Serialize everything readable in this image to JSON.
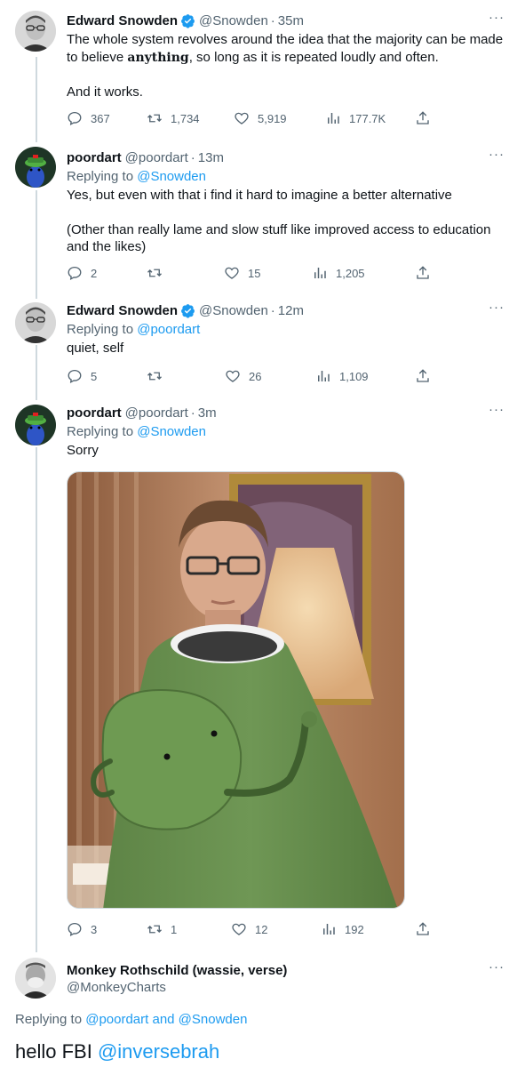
{
  "tweets": [
    {
      "name": "Edward Snowden",
      "handle": "@Snowden",
      "time": "35m",
      "verified": true,
      "text_1": "The whole system revolves around the idea that the majority can be made to believe ",
      "text_bold": "anything",
      "text_2": ", so long as it is repeated loudly and often.",
      "text_3": "And it works.",
      "replies": "367",
      "retweets": "1,734",
      "likes": "5,919",
      "views": "177.7K"
    },
    {
      "name": "poordart",
      "handle": "@poordart",
      "time": "13m",
      "replying_prefix": "Replying to ",
      "replying_to": "@Snowden",
      "text_1": "Yes, but even with that i find it hard to imagine a better alternative",
      "text_2": "(Other than really lame and slow stuff like improved access to education and the likes)",
      "replies": "2",
      "retweets": "",
      "likes": "15",
      "views": "1,205"
    },
    {
      "name": "Edward Snowden",
      "handle": "@Snowden",
      "time": "12m",
      "verified": true,
      "replying_prefix": "Replying to ",
      "replying_to": "@poordart",
      "text_1": "quiet, self",
      "replies": "5",
      "retweets": "",
      "likes": "26",
      "views": "1,109"
    },
    {
      "name": "poordart",
      "handle": "@poordart",
      "time": "3m",
      "replying_prefix": "Replying to ",
      "replying_to": "@Snowden",
      "text_1": "Sorry",
      "replies": "3",
      "retweets": "1",
      "likes": "12",
      "views": "192"
    },
    {
      "name": "Monkey Rothschild (wassie, verse)",
      "handle": "@MonkeyCharts",
      "replying_prefix": "Replying to ",
      "replying_to": "@poordart and @Snowden",
      "text_1": "hello FBI ",
      "mention": "@inversebrah"
    }
  ],
  "more_label": "···",
  "dot": "·",
  "colors": {
    "link": "#1d9bf0",
    "muted": "#536471",
    "verified": "#1d9bf0",
    "thread": "#cfd9de"
  }
}
